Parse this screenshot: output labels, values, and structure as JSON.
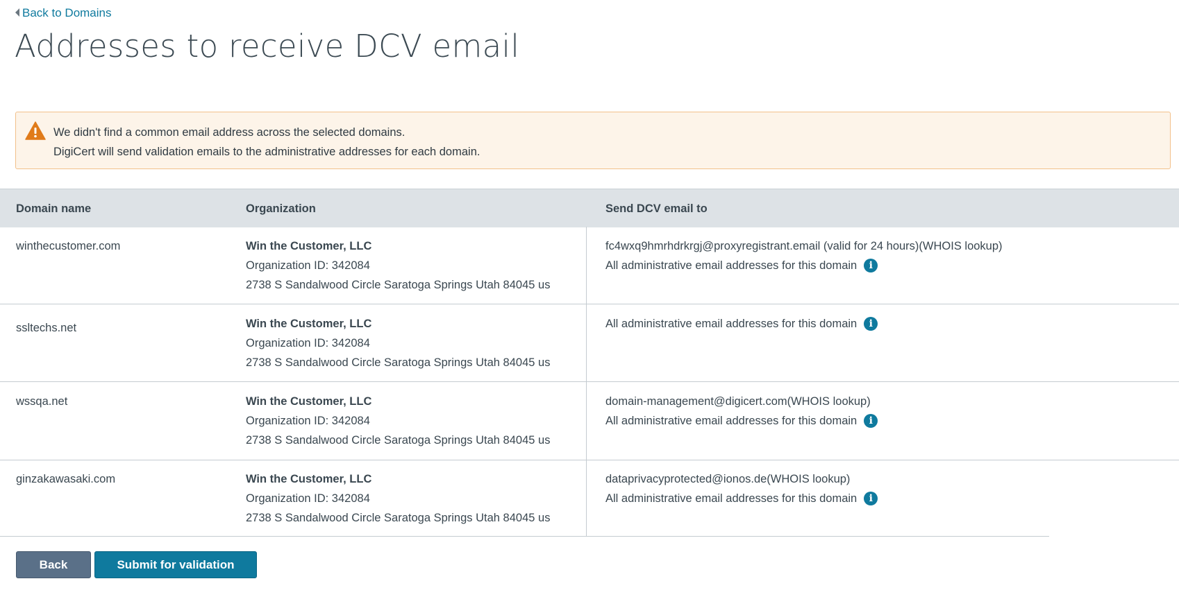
{
  "nav": {
    "back_link": "Back to Domains"
  },
  "page_title": "Addresses to receive DCV email",
  "alert": {
    "line1": "We didn't find a common email address across the selected domains.",
    "line2": "DigiCert will send validation emails to the administrative addresses for each domain."
  },
  "table": {
    "headers": [
      "Domain name",
      "Organization",
      "Send DCV email to"
    ],
    "rows": [
      {
        "domain": "winthecustomer.com",
        "org_name": "Win the Customer, LLC",
        "org_id": "Organization ID: 342084",
        "org_address": "2738 S Sandalwood Circle Saratoga Springs Utah 84045 us",
        "whois_email": "fc4wxq9hmrhdrkrgj@proxyregistrant.email (valid for 24 hours)(WHOIS lookup)",
        "admin_text": "All administrative email addresses for this domain"
      },
      {
        "domain": "ssltechs.net",
        "org_name": "Win the Customer, LLC",
        "org_id": "Organization ID: 342084",
        "org_address": "2738 S Sandalwood Circle Saratoga Springs Utah 84045 us",
        "admin_text": "All administrative email addresses for this domain"
      },
      {
        "domain": "wssqa.net",
        "org_name": "Win the Customer, LLC",
        "org_id": "Organization ID: 342084",
        "org_address": "2738 S Sandalwood Circle Saratoga Springs Utah 84045 us",
        "whois_email": "domain-management@digicert.com(WHOIS lookup)",
        "admin_text": "All administrative email addresses for this domain"
      },
      {
        "domain": "ginzakawasaki.com",
        "org_name": "Win the Customer, LLC",
        "org_id": "Organization ID: 342084",
        "org_address": "2738 S Sandalwood Circle Saratoga Springs Utah 84045 us",
        "whois_email": "dataprivacyprotected@ionos.de(WHOIS lookup)",
        "admin_text": "All administrative email addresses for this domain"
      }
    ]
  },
  "buttons": {
    "back": "Back",
    "submit": "Submit for validation"
  },
  "icons": {
    "info_glyph": "i"
  },
  "colors": {
    "accent": "#0f7a9e",
    "warning": "#e07b1a",
    "alert_bg": "#fdf4e9",
    "header_bg": "#dde2e6",
    "back_button": "#5a7088"
  }
}
